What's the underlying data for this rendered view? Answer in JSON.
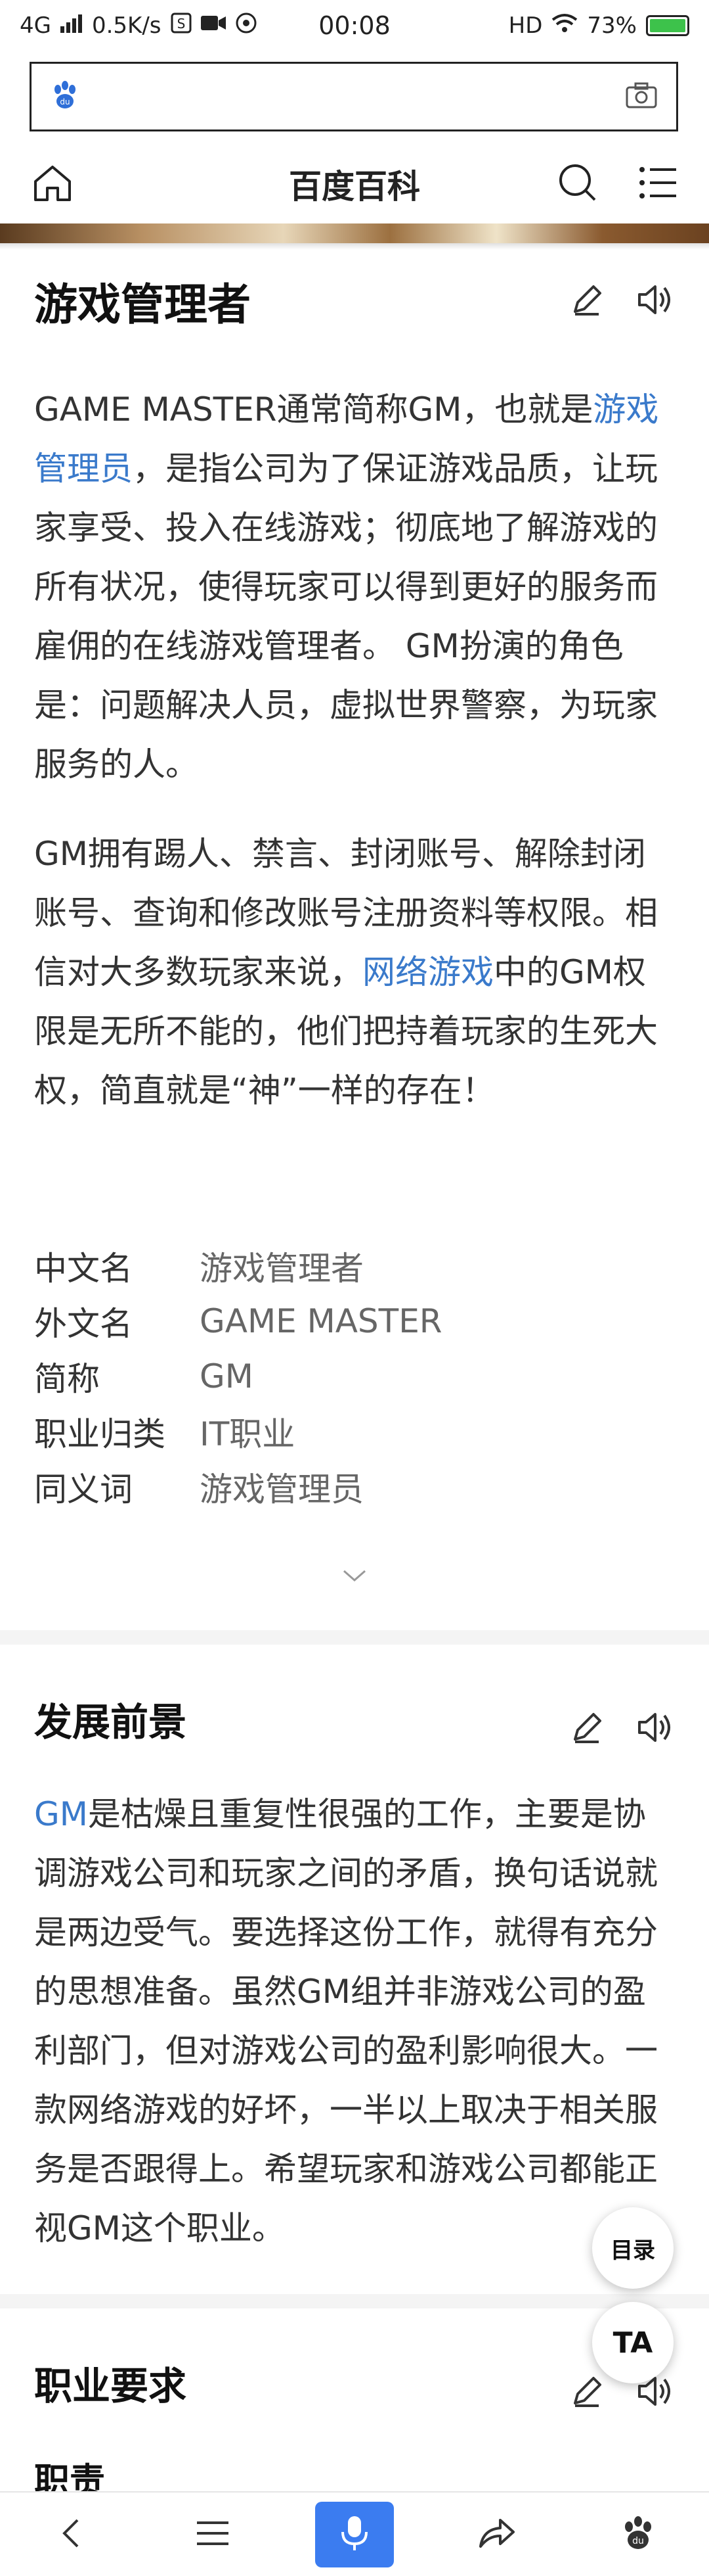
{
  "status_bar": {
    "network": "4G",
    "speed": "0.5K/s",
    "time": "00:08",
    "hd": "HD",
    "battery": "73%"
  },
  "search": {
    "placeholder": "",
    "value": ""
  },
  "nav": {
    "title": "百度百科"
  },
  "article": {
    "title": "游戏管理者",
    "intro_p1": {
      "text1": "GAME MASTER通常简称GM，也就是",
      "link1": "游戏管理员",
      "text2": "，是指公司为了保证游戏品质，让玩家享受、投入在线游戏；彻底地了解游戏的所有状况，使得玩家可以得到更好的服务而雇佣的在线游戏管理者。 GM扮演的角色是：问题解决人员，虚拟世界警察，为玩家服务的人。"
    },
    "intro_p2": {
      "text1": "GM拥有踢人、禁言、封闭账号、解除封闭账号、查询和修改账号注册资料等权限。相信对大多数玩家来说，",
      "link1": "网络游戏",
      "text2": "中的GM权限是无所不能的，他们把持着玩家的生死大权，简直就是“神”一样的存在！"
    },
    "infobox": [
      {
        "label": "中文名",
        "value": "游戏管理者"
      },
      {
        "label": "外文名",
        "value": "GAME MASTER"
      },
      {
        "label": "简称",
        "value": "GM"
      },
      {
        "label": "职业归类",
        "value": "IT职业"
      },
      {
        "label": "同义词",
        "value": "游戏管理员"
      }
    ],
    "sections": [
      {
        "title": "发展前景",
        "link": "GM",
        "text": "是枯燥且重复性很强的工作，主要是协调游戏公司和玩家之间的矛盾，换句话说就是两边受气。要选择这份工作，就得有充分的思想准备。虽然GM组并非游戏公司的盈利部门，但对游戏公司的盈利影响很大。一款网络游戏的好坏，一半以上取决于相关服务是否跟得上。希望玩家和游戏公司都能正视GM这个职业。"
      },
      {
        "title": "职业要求",
        "subtitle": "职责"
      }
    ]
  },
  "floating": {
    "toc_label": "目录",
    "font_label": "TA"
  },
  "colors": {
    "link": "#3a7acb",
    "mic_button": "#3b7cf0",
    "battery": "#3dc24b"
  }
}
